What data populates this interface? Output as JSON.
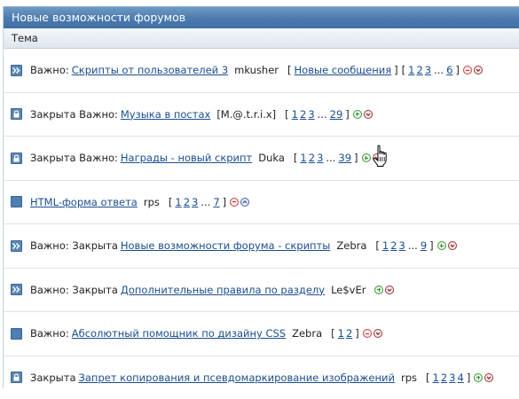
{
  "panel": {
    "title": "Новые возможности форумов",
    "column_header": "Тема"
  },
  "topics": [
    {
      "icon": "sticky-arrow-icon",
      "prefix": "Важно:",
      "title": "Скрипты от пользователей 3",
      "author": "mkusher",
      "new_posts": "Новые сообщения",
      "pages": [
        "1",
        "2",
        "3"
      ],
      "last_page": "6",
      "actions": [
        "minus-icon",
        "chevron-down-icon"
      ]
    },
    {
      "icon": "lock-icon",
      "prefix": "Закрыта Важно:",
      "title": "Музыка в постах",
      "author": "[M.@.t.r.i.x]",
      "pages": [
        "1",
        "2",
        "3"
      ],
      "last_page": "29",
      "actions": [
        "plus-icon",
        "chevron-down-icon"
      ]
    },
    {
      "icon": "lock-icon",
      "prefix": "Закрыта Важно:",
      "title": "Награды - новый скрипт",
      "author": "Duka",
      "pages": [
        "1",
        "2",
        "3"
      ],
      "last_page": "39",
      "actions": [
        "plus-icon",
        "chevron-down-icon"
      ]
    },
    {
      "icon": "square-icon",
      "prefix": "",
      "title": "HTML-форма ответа",
      "author": "rps",
      "pages": [
        "1",
        "2",
        "3"
      ],
      "last_page": "7",
      "actions": [
        "minus-icon",
        "chevron-up-icon"
      ]
    },
    {
      "icon": "sticky-arrow-icon",
      "prefix": "Важно: Закрыта",
      "title": "Новые возможности форума - скрипты",
      "author": "Zebra",
      "pages": [
        "1",
        "2",
        "3"
      ],
      "last_page": "9",
      "actions": [
        "plus-icon",
        "chevron-down-icon"
      ]
    },
    {
      "icon": "sticky-arrow-icon",
      "prefix": "Важно: Закрыта",
      "title": "Дополнительные правила по разделу",
      "author": "Le$vEr",
      "pages": [],
      "last_page": "",
      "actions": [
        "plus-icon",
        "chevron-down-icon"
      ]
    },
    {
      "icon": "square-icon",
      "prefix": "Важно:",
      "title": "Абсолютный помощник по дизайну CSS",
      "author": "Zebra",
      "pages": [
        "1",
        "2"
      ],
      "last_page": "",
      "actions": [
        "minus-icon",
        "chevron-down-icon"
      ]
    },
    {
      "icon": "lock-icon",
      "prefix": "Закрыта",
      "title": "Запрет копирования и псевдомаркирование изображений",
      "author": "rps",
      "pages": [
        "1",
        "2",
        "3",
        "4"
      ],
      "last_page": "",
      "actions": [
        "plus-icon",
        "chevron-down-icon"
      ]
    }
  ],
  "colors": {
    "title_bar": "#4d7db0",
    "link": "#1a4d8f",
    "minus": "#d04040",
    "plus": "#3a9a3a"
  }
}
